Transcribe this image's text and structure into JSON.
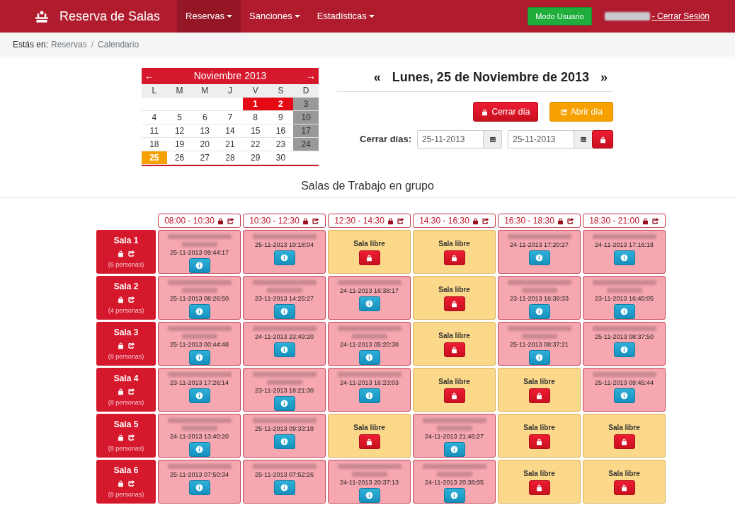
{
  "navbar": {
    "brand": "Reserva de Salas",
    "menus": [
      {
        "label": "Reservas",
        "selected": true
      },
      {
        "label": "Sanciones",
        "selected": false
      },
      {
        "label": "Estadísticas",
        "selected": false
      }
    ],
    "mode_button": "Modo Usuario",
    "logout": "- Cerrar Sesión"
  },
  "breadcrumb": {
    "prefix": "Estás en:",
    "items": [
      "Reservas",
      "Calendario"
    ],
    "separator": "/"
  },
  "calendar": {
    "prev": "←",
    "next": "→",
    "month": "Noviembre 2013",
    "weekdays": [
      "L",
      "M",
      "M",
      "J",
      "V",
      "S",
      "D"
    ],
    "weeks": [
      [
        {
          "kind": "blank"
        },
        {
          "kind": "blank"
        },
        {
          "kind": "blank"
        },
        {
          "kind": "blank"
        },
        {
          "day": "1",
          "kind": "closed"
        },
        {
          "day": "2",
          "kind": "closed"
        },
        {
          "day": "3",
          "kind": "holiday"
        }
      ],
      [
        {
          "day": "4",
          "kind": "normal"
        },
        {
          "day": "5",
          "kind": "normal"
        },
        {
          "day": "6",
          "kind": "normal"
        },
        {
          "day": "7",
          "kind": "normal"
        },
        {
          "day": "8",
          "kind": "normal"
        },
        {
          "day": "9",
          "kind": "normal"
        },
        {
          "day": "10",
          "kind": "holiday"
        }
      ],
      [
        {
          "day": "11",
          "kind": "normal"
        },
        {
          "day": "12",
          "kind": "normal"
        },
        {
          "day": "13",
          "kind": "normal"
        },
        {
          "day": "14",
          "kind": "normal"
        },
        {
          "day": "15",
          "kind": "normal"
        },
        {
          "day": "16",
          "kind": "normal"
        },
        {
          "day": "17",
          "kind": "holiday"
        }
      ],
      [
        {
          "day": "18",
          "kind": "normal"
        },
        {
          "day": "19",
          "kind": "normal"
        },
        {
          "day": "20",
          "kind": "normal"
        },
        {
          "day": "21",
          "kind": "normal"
        },
        {
          "day": "22",
          "kind": "normal"
        },
        {
          "day": "23",
          "kind": "normal"
        },
        {
          "day": "24",
          "kind": "holiday"
        }
      ],
      [
        {
          "day": "25",
          "kind": "today"
        },
        {
          "day": "26",
          "kind": "normal"
        },
        {
          "day": "27",
          "kind": "normal"
        },
        {
          "day": "28",
          "kind": "normal"
        },
        {
          "day": "29",
          "kind": "normal"
        },
        {
          "day": "30",
          "kind": "normal"
        },
        {
          "kind": "blank"
        }
      ]
    ]
  },
  "day_panel": {
    "prev": "«",
    "next": "»",
    "title": "Lunes, 25 de Noviembre de 2013",
    "close_day": "Cerrar día",
    "open_day": "Abrir día",
    "range_label": "Cerrar días:",
    "from": "25-11-2013",
    "to": "25-11-2013"
  },
  "section_title": "Salas de Trabajo en grupo",
  "slots": [
    "08:00 - 10:30",
    "10:30 - 12:30",
    "12:30 - 14:30",
    "14:30 - 16:30",
    "16:30 - 18:30",
    "18:30 - 21:00"
  ],
  "rooms": [
    {
      "name": "Sala 1",
      "capacity": "(6 personas)",
      "cells": [
        {
          "kind": "booked_long",
          "time": "25-11-2013 09:44:17"
        },
        {
          "kind": "booked_short",
          "time": "25-11-2013 10:18:04"
        },
        {
          "kind": "free",
          "label": "Sala libre"
        },
        {
          "kind": "free",
          "label": "Sala libre"
        },
        {
          "kind": "booked_short",
          "time": "24-11-2013 17:20:27"
        },
        {
          "kind": "booked_short",
          "time": "24-11-2013 17:16:18"
        }
      ]
    },
    {
      "name": "Sala 2",
      "capacity": "(4 personas)",
      "cells": [
        {
          "kind": "booked_long",
          "time": "25-11-2013 08:26:50"
        },
        {
          "kind": "booked_long",
          "time": "23-11-2013 14:25:27"
        },
        {
          "kind": "booked_short",
          "time": "24-11-2013 16:38:17"
        },
        {
          "kind": "free",
          "label": "Sala libre"
        },
        {
          "kind": "booked_long",
          "time": "23-11-2013 16:39:33"
        },
        {
          "kind": "booked_long",
          "time": "23-11-2013 16:45:05"
        }
      ]
    },
    {
      "name": "Sala 3",
      "capacity": "(8 personas)",
      "cells": [
        {
          "kind": "booked_long",
          "time": "25-11-2013 00:44:48"
        },
        {
          "kind": "booked_short",
          "time": "24-11-2013 23:49:20"
        },
        {
          "kind": "booked_long",
          "time": "24-11-2013 05:20:38"
        },
        {
          "kind": "free",
          "label": "Sala libre"
        },
        {
          "kind": "booked_long",
          "time": "25-11-2013 08:37:21"
        },
        {
          "kind": "booked_short",
          "time": "25-11-2013 08:37:50"
        }
      ]
    },
    {
      "name": "Sala 4",
      "capacity": "(8 personas)",
      "cells": [
        {
          "kind": "booked_short",
          "time": "23-11-2013 17:26:14"
        },
        {
          "kind": "booked_long",
          "time": "23-11-2013 18:21:30"
        },
        {
          "kind": "booked_short",
          "time": "24-11-2013 16:23:03"
        },
        {
          "kind": "free",
          "label": "Sala libre"
        },
        {
          "kind": "free",
          "label": "Sala libre"
        },
        {
          "kind": "booked_short",
          "time": "25-11-2013 09:45:44"
        }
      ]
    },
    {
      "name": "Sala 5",
      "capacity": "(8 personas)",
      "cells": [
        {
          "kind": "booked_long",
          "time": "24-11-2013 13:40:20"
        },
        {
          "kind": "booked_short",
          "time": "25-11-2013 09:33:18"
        },
        {
          "kind": "free",
          "label": "Sala libre"
        },
        {
          "kind": "booked_long",
          "time": "24-11-2013 21:46:27"
        },
        {
          "kind": "free",
          "label": "Sala libre"
        },
        {
          "kind": "free",
          "label": "Sala libre"
        }
      ]
    },
    {
      "name": "Sala 6",
      "capacity": "(8 personas)",
      "cells": [
        {
          "kind": "booked_short",
          "time": "25-11-2013 07:50:34"
        },
        {
          "kind": "booked_short",
          "time": "25-11-2013 07:52:26"
        },
        {
          "kind": "booked_long",
          "time": "24-11-2013 20:37:13"
        },
        {
          "kind": "booked_long",
          "time": "24-11-2013 20:38:05"
        },
        {
          "kind": "free",
          "label": "Sala libre"
        },
        {
          "kind": "free",
          "label": "Sala libre"
        }
      ]
    }
  ]
}
